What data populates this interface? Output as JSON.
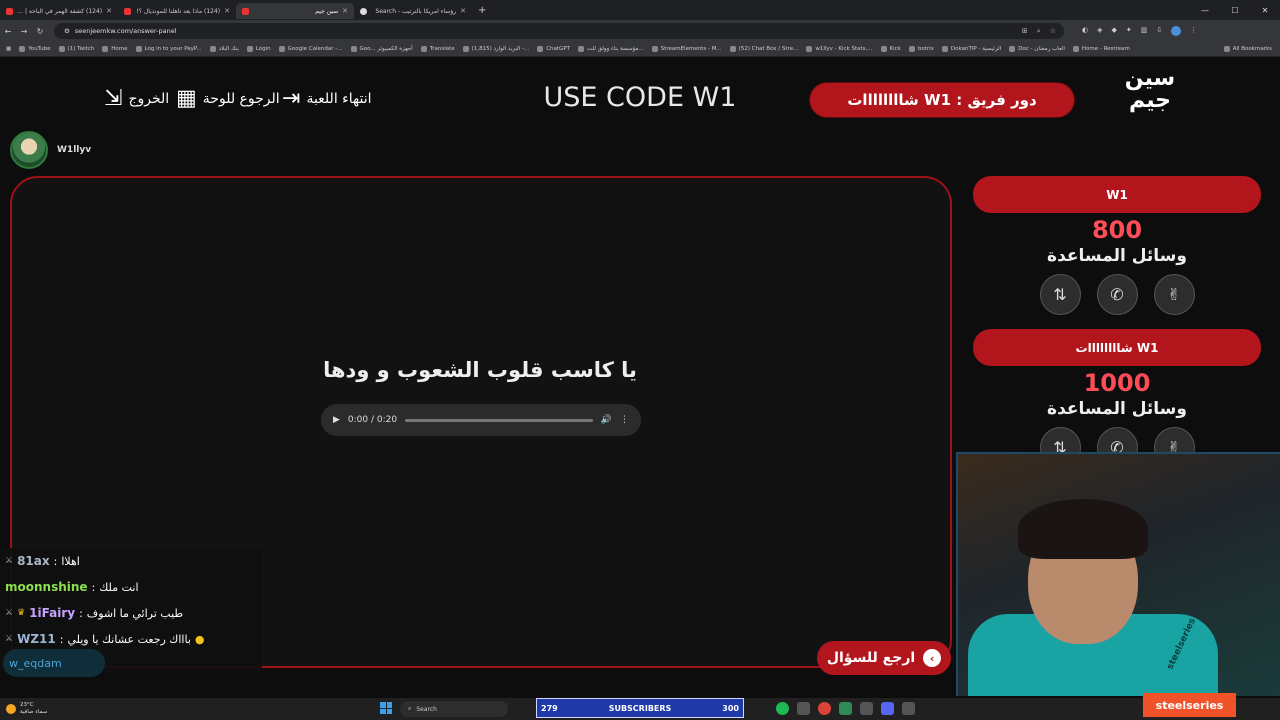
{
  "browser": {
    "tabs": [
      {
        "label": "(124) كشفة الهمر في الباحة | مع"
      },
      {
        "label": "(124) ماذا بعد تأهلنا للمونديال ؟!"
      },
      {
        "label": "سين جيم",
        "active": true
      },
      {
        "label": "رؤساء امريكا بالترتيب - Search"
      }
    ],
    "new_tab": "+",
    "url": "seenjeemkw.com/answer-panel",
    "bookmarks": [
      "YouTube",
      "(1) Twitch",
      "Home",
      "Log in to your PayP...",
      "بنك البلاد",
      "Login",
      "Google Calendar -...",
      "Goo... أجهزة الكمبيوتر",
      "Translate",
      "البريد الوارد (1,815) -...",
      "ChatGPT",
      "مؤسسة بناء وولق للت...",
      "StreamElements - M...",
      "(52) Chat Box / Stre...",
      "w1llyv - Kick Stats,...",
      "Kick",
      "botrix",
      "DokanTIP - الرئيسية",
      "Doc - العاب رمضان",
      "Home - Restream"
    ],
    "all_bookmarks": "All Bookmarks"
  },
  "header": {
    "logo": "سين\nجيم",
    "team_turn": "دور فريق : W1 شاااااااات",
    "promo": "USE CODE W1",
    "end_game": "انتهاء اللعبة",
    "back_to_board": "الرجوع للوحة",
    "exit": "الخروج"
  },
  "user": {
    "name": "W1llyv"
  },
  "question": {
    "text": "يا كاسب قلوب الشعوب و ودها",
    "audio_time": "0:00 / 0:20",
    "back_button": "ارجع للسؤال"
  },
  "teams": [
    {
      "name": "W1",
      "score": "800",
      "helps_label": "وسائل المساعدة"
    },
    {
      "name": "W1 شاااااااات",
      "score": "1000",
      "helps_label": "وسائل المساعدة"
    }
  ],
  "help_icons": [
    "swap-icon",
    "phone-icon",
    "peace-hand-icon"
  ],
  "chat": [
    {
      "user": "81ax",
      "msg": "اهلاا",
      "color": "#aab7c4"
    },
    {
      "user": "moonnshine",
      "msg": "انت ملك",
      "color": "#8be04e"
    },
    {
      "user": "1iFairy",
      "msg": "طيب ترائي ما اشوف",
      "color": "#c8a2ff"
    },
    {
      "user": "WZ11",
      "msg": "باااك رجعت عشانك يا ويلي",
      "color": "#9fb6d6"
    }
  ],
  "chat_input": "w_eqdam",
  "stream": {
    "subscribers_label": "SUBSCRIBERS",
    "sub_current": "279",
    "sub_goal": "300",
    "sponsor": "steelseries",
    "shirt_brand": "steelseries"
  },
  "taskbar": {
    "temp": "23°C",
    "weather": "سماء صافية",
    "search": "Search"
  },
  "colors": {
    "accent": "#b3151c",
    "score": "#ff4d57"
  }
}
